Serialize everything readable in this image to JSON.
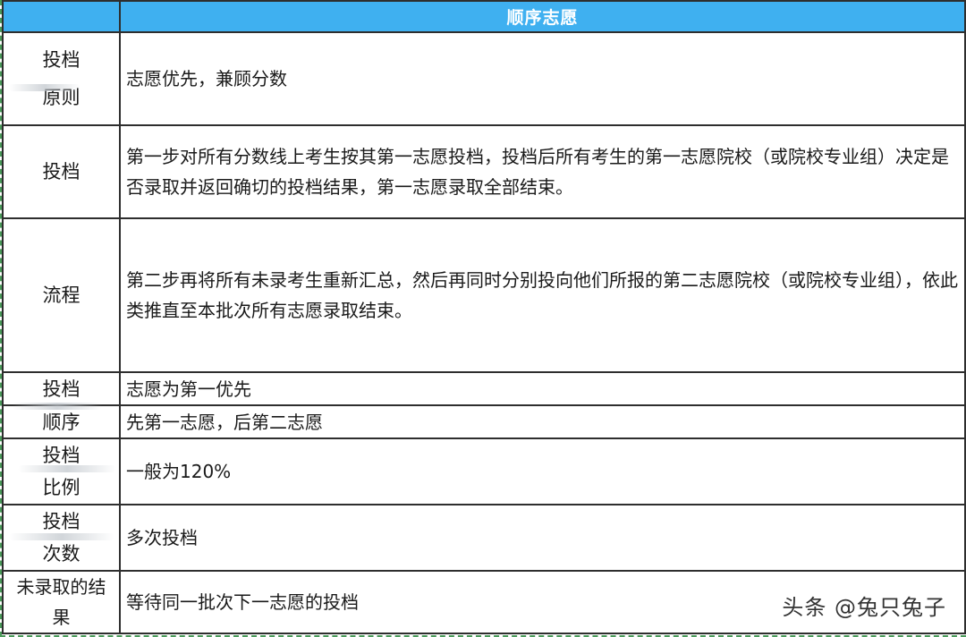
{
  "table": {
    "header_title": "顺序志愿",
    "rows": [
      {
        "label_lines": [
          "投档",
          "原则"
        ],
        "content": "志愿优先，兼顾分数"
      },
      {
        "label_lines": [
          "投档"
        ],
        "content": "第一步对所有分数线上考生按其第一志愿投档，投档后所有考生的第一志愿院校（或院校专业组）决定是否录取并返回确切的投档结果，第一志愿录取全部结束。"
      },
      {
        "label_lines": [
          "流程"
        ],
        "content": "第二步再将所有未录考生重新汇总，然后再同时分别投向他们所报的第二志愿院校（或院校专业组），依此类推直至本批次所有志愿录取结束。"
      },
      {
        "label_lines": [
          "投档"
        ],
        "content": "志愿为第一优先"
      },
      {
        "label_lines": [
          "顺序"
        ],
        "content": "先第一志愿，后第二志愿"
      },
      {
        "label_lines": [
          "投档",
          "比例"
        ],
        "content": "一般为120%"
      },
      {
        "label_lines": [
          "投档",
          "次数"
        ],
        "content": "多次投档"
      },
      {
        "label_lines": [
          "未录取的结",
          "果"
        ],
        "content": "等待同一批次下一志愿的投档"
      }
    ]
  },
  "watermark": "头条 @兔只兔子",
  "colors": {
    "header_bg": "#3fb0f0",
    "border": "#2e2e2e",
    "frame_dashed": "#4a9a5a"
  }
}
